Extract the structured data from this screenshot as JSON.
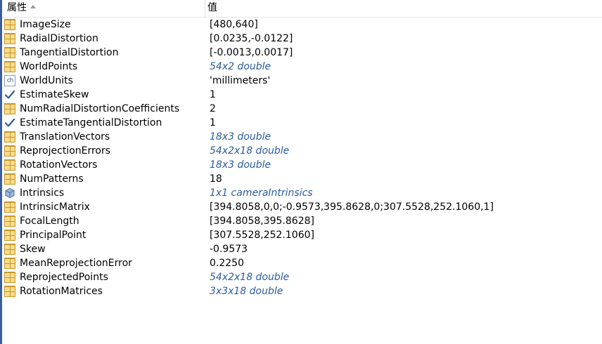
{
  "header": {
    "name_label": "属性",
    "value_label": "值"
  },
  "rows": [
    {
      "name": "ImageSize",
      "value": "[480,640]",
      "icon": "table-icon",
      "link": false
    },
    {
      "name": "RadialDistortion",
      "value": "[0.0235,-0.0122]",
      "icon": "table-icon",
      "link": false
    },
    {
      "name": "TangentialDistortion",
      "value": "[-0.0013,0.0017]",
      "icon": "table-icon",
      "link": false
    },
    {
      "name": "WorldPoints",
      "value": "54x2 double",
      "icon": "table-icon",
      "link": true
    },
    {
      "name": "WorldUnits",
      "value": "'millimeters'",
      "icon": "char-icon",
      "link": false
    },
    {
      "name": "EstimateSkew",
      "value": "1",
      "icon": "checkmark-icon",
      "link": false
    },
    {
      "name": "NumRadialDistortionCoefficients",
      "value": "2",
      "icon": "table-icon",
      "link": false
    },
    {
      "name": "EstimateTangentialDistortion",
      "value": "1",
      "icon": "checkmark-icon",
      "link": false
    },
    {
      "name": "TranslationVectors",
      "value": "18x3 double",
      "icon": "table-icon",
      "link": true
    },
    {
      "name": "ReprojectionErrors",
      "value": "54x2x18 double",
      "icon": "table-icon",
      "link": true
    },
    {
      "name": "RotationVectors",
      "value": "18x3 double",
      "icon": "table-icon",
      "link": true
    },
    {
      "name": "NumPatterns",
      "value": "18",
      "icon": "table-icon",
      "link": false
    },
    {
      "name": "Intrinsics",
      "value": "1x1 cameraIntrinsics",
      "icon": "object-icon",
      "link": true
    },
    {
      "name": "IntrinsicMatrix",
      "value": "[394.8058,0,0;-0.9573,395.8628,0;307.5528,252.1060,1]",
      "icon": "table-icon",
      "link": false
    },
    {
      "name": "FocalLength",
      "value": "[394.8058,395.8628]",
      "icon": "table-icon",
      "link": false
    },
    {
      "name": "PrincipalPoint",
      "value": "[307.5528,252.1060]",
      "icon": "table-icon",
      "link": false
    },
    {
      "name": "Skew",
      "value": "-0.9573",
      "icon": "table-icon",
      "link": false
    },
    {
      "name": "MeanReprojectionError",
      "value": "0.2250",
      "icon": "table-icon",
      "link": false
    },
    {
      "name": "ReprojectedPoints",
      "value": "54x2x18 double",
      "icon": "table-icon",
      "link": true
    },
    {
      "name": "RotationMatrices",
      "value": "3x3x18 double",
      "icon": "table-icon",
      "link": true
    }
  ],
  "icon_text": {
    "char_icon": "ch"
  },
  "colors": {
    "link": "#2a5d9b",
    "table_icon_fill": "#f9dd8c",
    "table_icon_stroke": "#c9962a",
    "left_border": "#3b5f9e"
  }
}
